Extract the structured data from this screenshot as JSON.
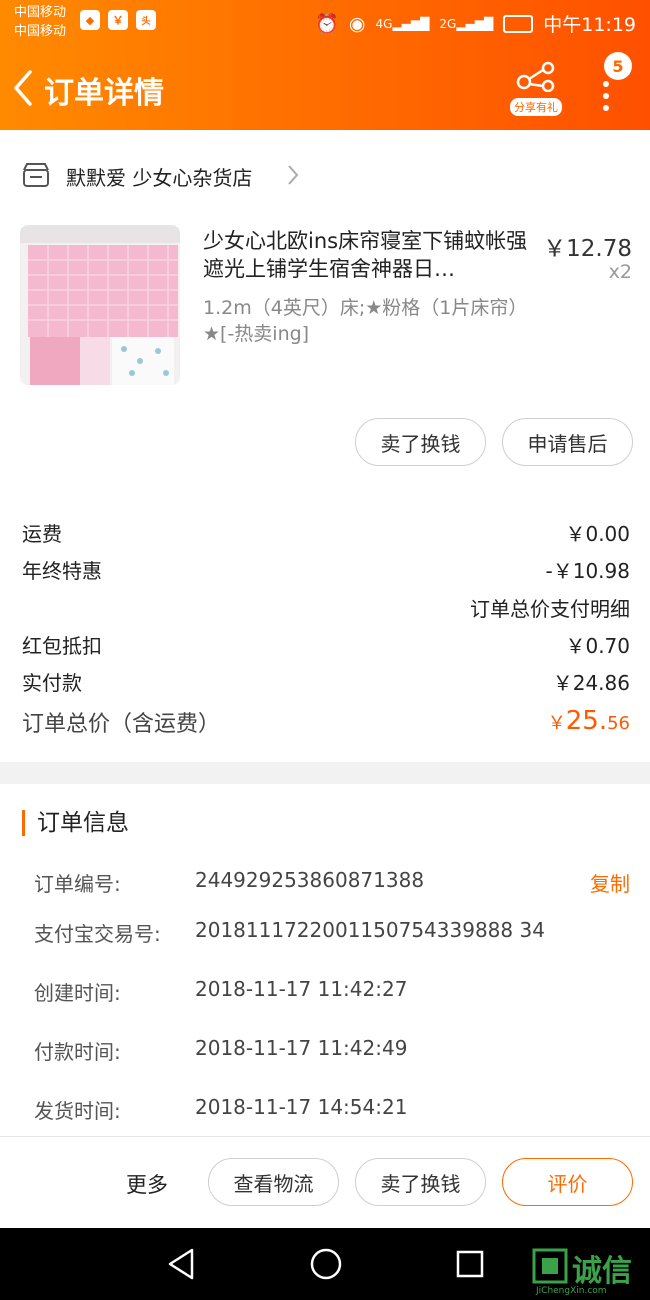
{
  "status_bar": {
    "carrier_1": "中国移动",
    "carrier_2": "中国移动",
    "network_1": "4G",
    "network_2": "2G",
    "time": "中午11:19"
  },
  "navbar": {
    "title": "订单详情",
    "share_label": "分享有礼",
    "badge_count": "5"
  },
  "shop": {
    "name": "默默爱 少女心杂货店"
  },
  "product": {
    "title": "少女心北欧ins床帘寝室下铺蚊帐强遮光上铺学生宿舍神器日…",
    "sku": "1.2m（4英尺）床;★粉格（1片床帘）★[-热卖ing]",
    "price": "￥12.78",
    "quantity": "x2"
  },
  "product_actions": {
    "sell_label": "卖了换钱",
    "after_sale_label": "申请售后"
  },
  "fees": {
    "shipping_label": "运费",
    "shipping_value": "￥0.00",
    "promo_label": "年终特惠",
    "promo_value": "-￥10.98",
    "detail_link": "订单总价支付明细",
    "redpacket_label": "红包抵扣",
    "redpacket_value": "￥0.70",
    "paid_label": "实付款",
    "paid_value": "￥24.86",
    "total_label": "订单总价（含运费）",
    "total_symbol": "￥",
    "total_integer": "25.",
    "total_decimal": "56"
  },
  "order_info": {
    "section_title": "订单信息",
    "copy_label": "复制",
    "rows": [
      {
        "label": "订单编号:",
        "value": "244929253860871388"
      },
      {
        "label": "支付宝交易号:",
        "value": "2018111722001150754339888 34"
      },
      {
        "label": "创建时间:",
        "value": "2018-11-17 11:42:27"
      },
      {
        "label": "付款时间:",
        "value": "2018-11-17 11:42:49"
      },
      {
        "label": "发货时间:",
        "value": "2018-11-17 14:54:21"
      }
    ]
  },
  "bottom_bar": {
    "more_label": "更多",
    "logistics_label": "查看物流",
    "sell_label": "卖了换钱",
    "review_label": "评价"
  },
  "watermark": {
    "brand": "诚信",
    "site": "JiChengXin.com"
  },
  "colors": {
    "accent": "#ff6a00",
    "header_start": "#ff8a00",
    "header_end": "#ff5000"
  }
}
